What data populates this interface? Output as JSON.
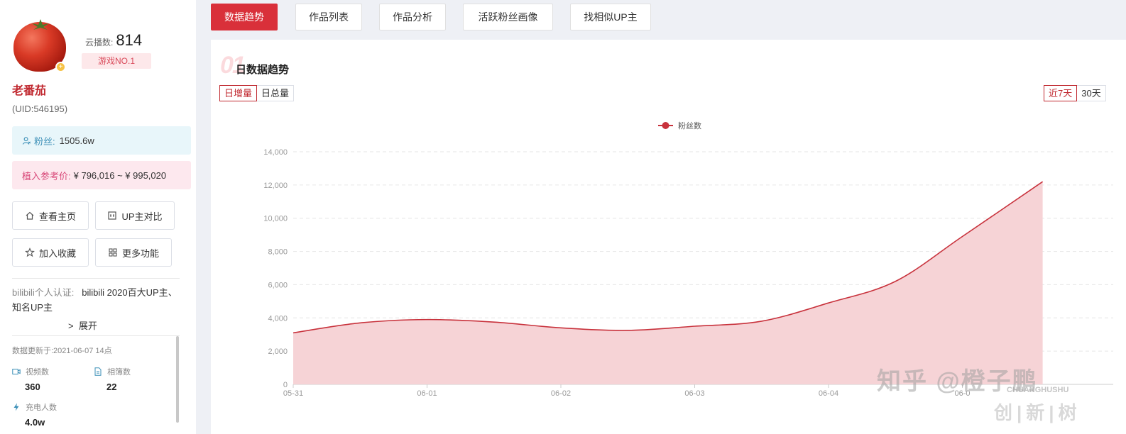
{
  "profile": {
    "name": "老番茄",
    "uid": "(UID:546195)",
    "cloud_play_label": "云播数:",
    "cloud_play_value": "814",
    "rank": "游戏NO.1",
    "fans_label": "粉丝:",
    "fans_value": "1505.6w",
    "price_label": "植入参考价:",
    "price_value": "¥ 796,016 ~ ¥ 995,020",
    "cert_label": "bilibili个人认证:",
    "cert_value": "bilibili 2020百大UP主、知名UP主",
    "expand": "展开",
    "updated": "数据更新于:2021-06-07 14点"
  },
  "actions": {
    "home": "查看主页",
    "compare": "UP主对比",
    "favorite": "加入收藏",
    "more": "更多功能"
  },
  "stats": {
    "videos_label": "视频数",
    "videos_value": "360",
    "albums_label": "相簿数",
    "albums_value": "22",
    "charge_label": "充电人数",
    "charge_value": "4.0w"
  },
  "tabs": [
    "数据趋势",
    "作品列表",
    "作品分析",
    "活跃粉丝画像",
    "找相似UP主"
  ],
  "section": {
    "number": "01",
    "title": "日数据趋势",
    "mode_increment": "日增量",
    "mode_total": "日总量",
    "range_7": "近7天",
    "range_30": "30天"
  },
  "watermark": {
    "main": "知乎 @橙子鹏",
    "sub": "CHUANGHUSHU",
    "cn": "创|新|树"
  },
  "colors": {
    "accent": "#d9303a",
    "series": "#c8323c",
    "area": "#f6d3d6"
  },
  "chart_data": {
    "type": "area",
    "legend": "粉丝数",
    "legend_position": "top-center",
    "x_ticks": [
      "05-31",
      "06-01",
      "06-02",
      "06-03",
      "06-04",
      "06-05"
    ],
    "x_tick_labels": [
      "05-31",
      "06-01",
      "06-02",
      "06-03",
      "06-04",
      "06-0"
    ],
    "ylim": [
      0,
      14000
    ],
    "y_ticks": [
      "0",
      "2,000",
      "4,000",
      "6,000",
      "8,000",
      "10,000",
      "12,000",
      "14,000"
    ],
    "grid": true,
    "series": [
      {
        "name": "粉丝数",
        "x": [
          0,
          0.5,
          1,
          1.5,
          2,
          2.5,
          3,
          3.5,
          4,
          4.5,
          5,
          5.6
        ],
        "values": [
          3100,
          3700,
          3900,
          3750,
          3400,
          3250,
          3500,
          3800,
          4900,
          6200,
          8900,
          12200
        ]
      }
    ]
  }
}
